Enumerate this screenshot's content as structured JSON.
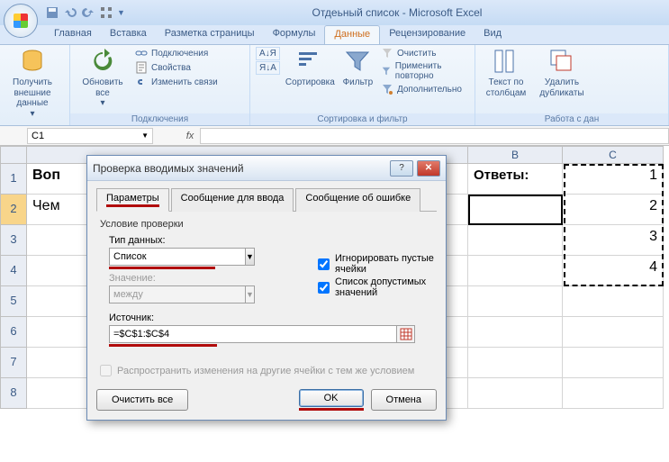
{
  "window": {
    "title": "Отдеьный список - Microsoft Excel"
  },
  "tabs": {
    "home": "Главная",
    "insert": "Вставка",
    "layout": "Разметка страницы",
    "formulas": "Формулы",
    "data": "Данные",
    "review": "Рецензирование",
    "view": "Вид"
  },
  "ribbon": {
    "get_data": "Получить внешние данные",
    "refresh": "Обновить все",
    "conn": "Подключения",
    "props": "Свойства",
    "editlinks": "Изменить связи",
    "group_conn": "Подключения",
    "sortAZ": "А↓Я",
    "sortZA": "Я↓А",
    "sort": "Сортировка",
    "filter": "Фильтр",
    "clear": "Очистить",
    "reapply": "Применить повторно",
    "advanced": "Дополнительно",
    "group_sort": "Сортировка и фильтр",
    "text_to_cols": "Текст по столбцам",
    "remove_dup": "Удалить дубликаты",
    "group_tools": "Работа с дан"
  },
  "namebox": "C1",
  "grid": {
    "colB": "B",
    "colC": "C",
    "r1": "1",
    "r2": "2",
    "r3": "3",
    "r4": "4",
    "r5": "5",
    "r6": "6",
    "r7": "7",
    "r8": "8",
    "a1": "Воп",
    "a2": "Чем",
    "b1": "Ответы:",
    "c1": "1",
    "c2": "2",
    "c3": "3",
    "c4": "4"
  },
  "dialog": {
    "title": "Проверка вводимых значений",
    "tab_params": "Параметры",
    "tab_input": "Сообщение для ввода",
    "tab_error": "Сообщение об ошибке",
    "cond_title": "Условие проверки",
    "type_label": "Тип данных:",
    "type_value": "Список",
    "value_label": "Значение:",
    "value_value": "между",
    "ignore_blank": "Игнорировать пустые ячейки",
    "allow_list": "Список допустимых значений",
    "source_label": "Источник:",
    "source_value": "=$C$1:$C$4",
    "propagate": "Распространить изменения на другие ячейки с тем же условием",
    "clear": "Очистить все",
    "ok": "OK",
    "cancel": "Отмена"
  }
}
